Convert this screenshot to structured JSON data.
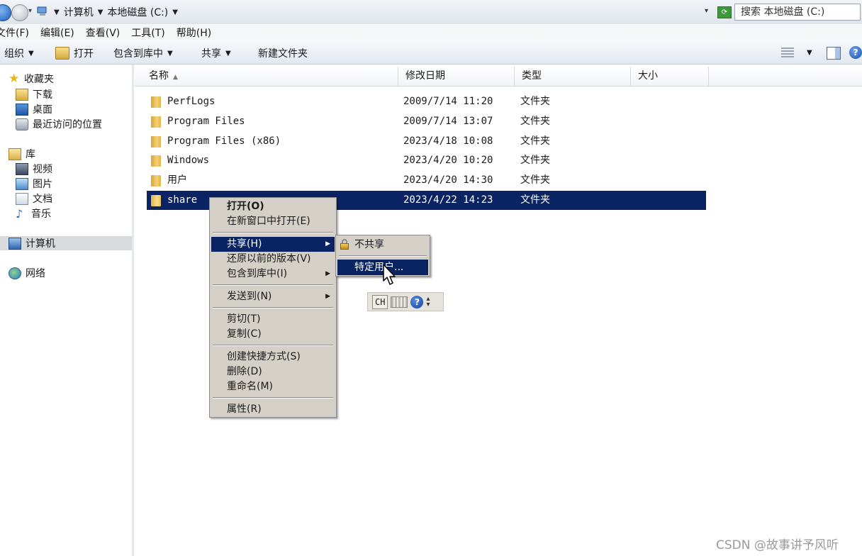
{
  "address": {
    "crumbs": [
      "计算机",
      "本地磁盘 (C:)"
    ],
    "search_placeholder": "搜索 本地磁盘 (C:)"
  },
  "menubar": [
    "文件(F)",
    "编辑(E)",
    "查看(V)",
    "工具(T)",
    "帮助(H)"
  ],
  "toolbar": {
    "organize": "组织",
    "open": "打开",
    "include_library": "包含到库中",
    "share": "共享",
    "new_folder": "新建文件夹"
  },
  "navpane": {
    "favorites": "收藏夹",
    "downloads": "下载",
    "desktop": "桌面",
    "recent": "最近访问的位置",
    "libraries": "库",
    "videos": "视频",
    "pictures": "图片",
    "documents": "文档",
    "music": "音乐",
    "computer": "计算机",
    "network": "网络"
  },
  "columns": [
    "名称",
    "修改日期",
    "类型",
    "大小"
  ],
  "files": [
    {
      "name": "PerfLogs",
      "date": "2009/7/14 11:20",
      "type": "文件夹",
      "selected": false
    },
    {
      "name": "Program Files",
      "date": "2009/7/14 13:07",
      "type": "文件夹",
      "selected": false
    },
    {
      "name": "Program Files (x86)",
      "date": "2023/4/18 10:08",
      "type": "文件夹",
      "selected": false
    },
    {
      "name": "Windows",
      "date": "2023/4/20 10:20",
      "type": "文件夹",
      "selected": false
    },
    {
      "name": "用户",
      "date": "2023/4/20 14:30",
      "type": "文件夹",
      "selected": false
    },
    {
      "name": "share",
      "date": "2023/4/22 14:23",
      "type": "文件夹",
      "selected": true
    }
  ],
  "context_menu": {
    "open": "打开(O)",
    "open_new_window": "在新窗口中打开(E)",
    "share": "共享(H)",
    "restore_versions": "还原以前的版本(V)",
    "include_library": "包含到库中(I)",
    "send_to": "发送到(N)",
    "cut": "剪切(T)",
    "copy": "复制(C)",
    "create_shortcut": "创建快捷方式(S)",
    "delete": "删除(D)",
    "rename": "重命名(M)",
    "properties": "属性(R)"
  },
  "share_submenu": {
    "no_share": "不共享",
    "specific_users": "特定用户..."
  },
  "langbar": {
    "lang": "CH"
  },
  "watermark": "CSDN @故事讲予风听",
  "colors": {
    "selection": "#0a2463",
    "menu_bg": "#d4d0c8"
  }
}
